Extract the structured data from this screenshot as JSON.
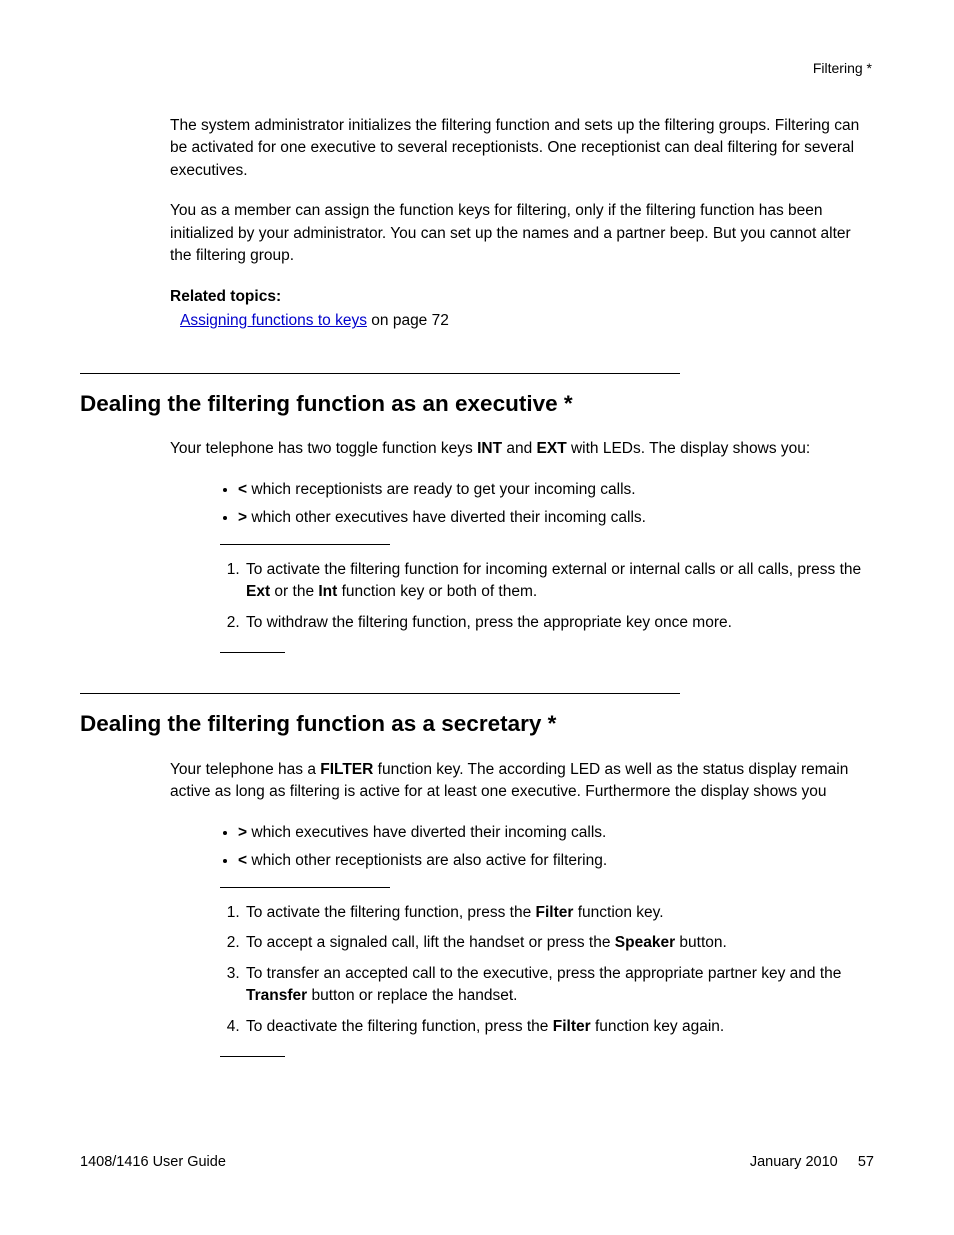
{
  "runningHead": "Filtering *",
  "intro": {
    "p1": "The system administrator initializes the filtering function and sets up the filtering groups. Filtering can be activated for one executive to several receptionists. One receptionist can deal filtering for several executives.",
    "p2": "You as a member can assign the function keys for filtering, only if the filtering function has been initialized by your administrator. You can set up the names and a partner beep. But you cannot alter the filtering group.",
    "relatedLabel": "Related topics:",
    "relatedLinkText": "Assigning functions to keys",
    "relatedSuffix": " on page 72"
  },
  "exec": {
    "title": "Dealing the filtering function as an executive *",
    "intro_pre": "Your telephone has two toggle function keys  ",
    "intro_b1": "INT",
    "intro_mid": " and ",
    "intro_b2": "EXT",
    "intro_post": " with LEDs. The display shows you:",
    "b1_pre": "",
    "b1_b": "<",
    "b1_post": " which receptionists are ready to get your incoming calls.",
    "b2_pre": "",
    "b2_b": ">",
    "b2_post": " which other executives have diverted their incoming calls.",
    "s1_pre": "To activate the filtering function for incoming external or internal calls or all calls, press the ",
    "s1_b1": "Ext",
    "s1_mid": " or the ",
    "s1_b2": "Int",
    "s1_post": " function key or both of them.",
    "s2": "To withdraw the filtering function, press the appropriate key once more."
  },
  "sec": {
    "title": "Dealing the filtering function as a secretary *",
    "intro_pre": "Your telephone has a ",
    "intro_b1": "FILTER",
    "intro_post": " function key. The according LED as well as the status display remain active as long as filtering is active for at least one executive. Furthermore the display shows you",
    "b1_b": ">",
    "b1_post": " which executives have diverted their incoming calls.",
    "b2_b": "<",
    "b2_post": " which other receptionists are also active for filtering.",
    "s1_pre": "To activate the filtering function, press the ",
    "s1_b1": "Filter",
    "s1_post": " function key.",
    "s2_pre": "To accept a signaled call, lift the handset or press the ",
    "s2_b1": "Speaker",
    "s2_post": " button.",
    "s3_pre": "To transfer an accepted call to the executive, press the appropriate partner key and the ",
    "s3_b1": "Transfer",
    "s3_post": " button or replace the handset.",
    "s4_pre": "To deactivate the filtering function, press the ",
    "s4_b1": "Filter",
    "s4_post": " function key again."
  },
  "footer": {
    "left": "1408/1416 User Guide",
    "right": "January 2010     57"
  }
}
